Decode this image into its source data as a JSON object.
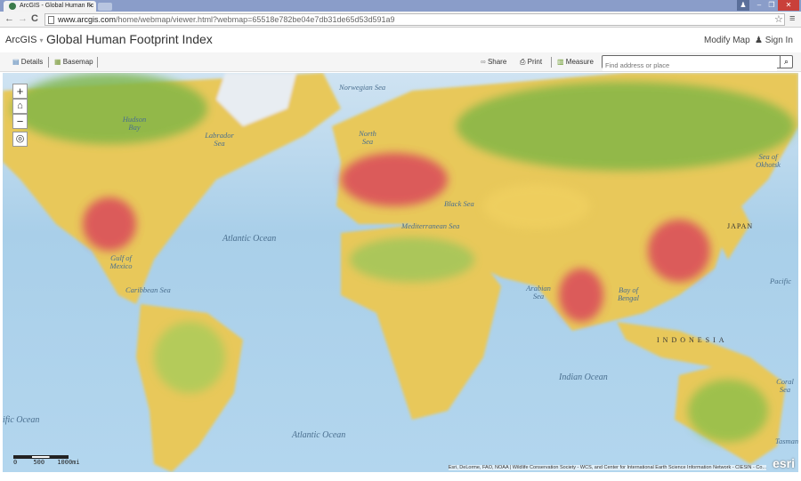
{
  "browser": {
    "tab_title": "ArcGIS - Global Human Fc",
    "url_host": "www.arcgis.com",
    "url_path": "/home/webmap/viewer.html?webmap=65518e782be04e7db31de65d53d591a9"
  },
  "header": {
    "brand": "ArcGIS",
    "title": "Global Human Footprint Index",
    "modify_map": "Modify Map",
    "sign_in": "Sign In"
  },
  "toolbar": {
    "details": "Details",
    "basemap": "Basemap",
    "share": "Share",
    "print": "Print",
    "measure": "Measure",
    "search_placeholder": "Find address or place"
  },
  "map": {
    "zoom_in": "+",
    "zoom_out": "−",
    "labels": {
      "norwegian_sea": "Norwegian Sea",
      "hudson_bay": "Hudson Bay",
      "labrador_sea": "Labrador Sea",
      "north_sea": "North Sea",
      "black_sea": "Black Sea",
      "mediterranean": "Mediterranean Sea",
      "okhotsk": "Sea of Okhotsk",
      "atlantic_n": "Atlantic Ocean",
      "gulf_mexico": "Gulf of Mexico",
      "caribbean": "Caribbean Sea",
      "arabian": "Arabian Sea",
      "bengal": "Bay of Bengal",
      "japan": "JAPAN",
      "indonesia": "INDONESIA",
      "pacific_e": "Pacific",
      "indian": "Indian Ocean",
      "coral": "Coral Sea",
      "pacific_w": "ific Ocean",
      "atlantic_s": "Atlantic Ocean",
      "tasman": "Tasman"
    },
    "scale": {
      "s0": "0",
      "s1": "500",
      "s2": "1000mi"
    },
    "attribution": "Esri, DeLorme, FAO, NOAA | Wildlife Conservation Society - WCS, and Center for International Earth Science Information Network - CIESIN - Co...",
    "esri_logo": "esri"
  }
}
